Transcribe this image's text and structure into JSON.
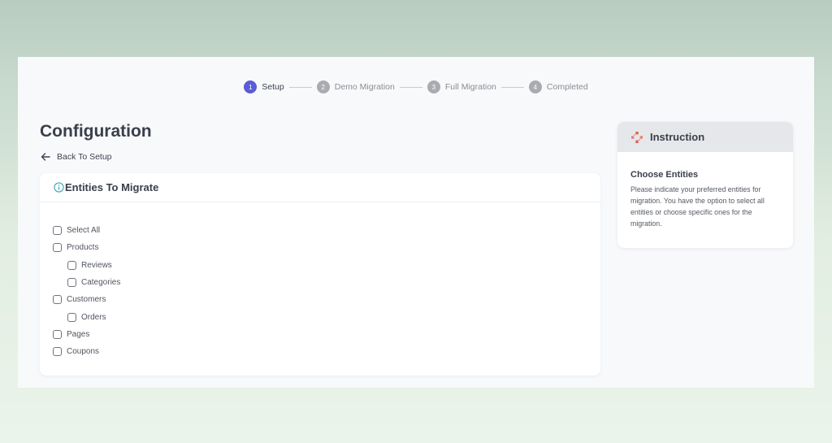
{
  "stepper": {
    "steps": [
      {
        "number": "1",
        "label": "Setup",
        "active": true
      },
      {
        "number": "2",
        "label": "Demo Migration",
        "active": false
      },
      {
        "number": "3",
        "label": "Full Migration",
        "active": false
      },
      {
        "number": "4",
        "label": "Completed",
        "active": false
      }
    ]
  },
  "header": {
    "title": "Configuration",
    "back_label": "Back To Setup"
  },
  "entities_card": {
    "title": "Entities To Migrate",
    "items": [
      {
        "label": "Select All",
        "checked": false,
        "child": false
      },
      {
        "label": "Products",
        "checked": false,
        "child": false
      },
      {
        "label": "Reviews",
        "checked": false,
        "child": true
      },
      {
        "label": "Categories",
        "checked": false,
        "child": true
      },
      {
        "label": "Customers",
        "checked": false,
        "child": false
      },
      {
        "label": "Orders",
        "checked": false,
        "child": true
      },
      {
        "label": "Pages",
        "checked": false,
        "child": false
      },
      {
        "label": "Coupons",
        "checked": false,
        "child": false
      }
    ]
  },
  "instruction": {
    "header": "Instruction",
    "title": "Choose Entities",
    "text": "Please indicate your preferred entities for migration. You have the option to select all entities or choose specific ones for the migration."
  },
  "colors": {
    "accent": "#5b5bd6",
    "info_icon": "#3aa6b9",
    "instruction_icon": "#e0604f"
  }
}
